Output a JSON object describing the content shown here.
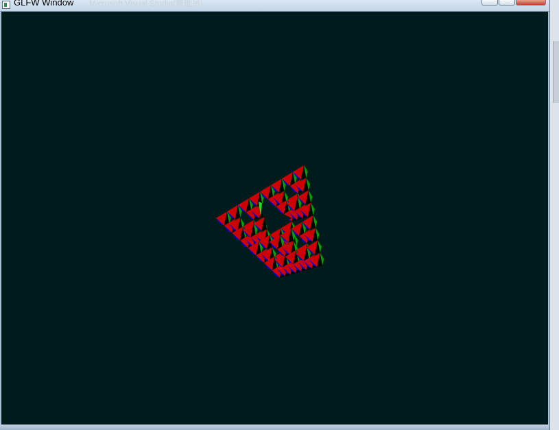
{
  "window": {
    "title": "GLFW Window",
    "clear_color": "#001b1b"
  },
  "background_tabs": {
    "tab_1": "Microsoft Visual Studio(管理员)",
    "tab_2": ""
  },
  "scene": {
    "object": "sierpinski-tetrahedron",
    "face_colors": [
      "#cc0000",
      "#00a000",
      "#0000dd",
      "#000000"
    ]
  }
}
